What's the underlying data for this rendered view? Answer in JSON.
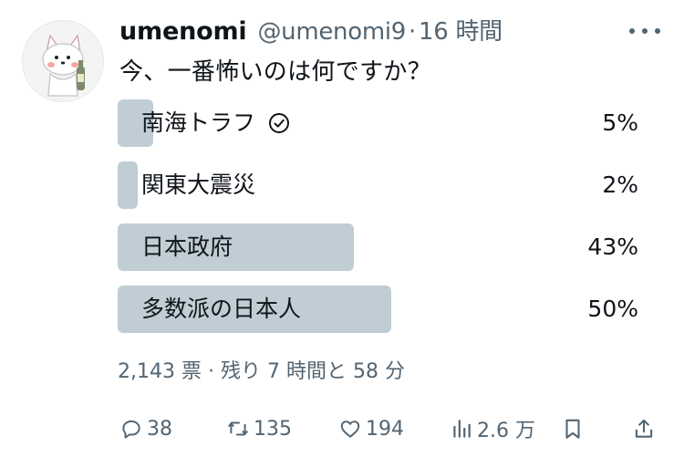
{
  "tweet": {
    "display_name": "umenomi",
    "handle": "@umenomi9",
    "separator": "·",
    "time": "16 時間",
    "text": "今、一番怖いのは何ですか？"
  },
  "poll": {
    "options": [
      {
        "label": "南海トラフ",
        "percent_text": "5%",
        "fraction": 0.05,
        "selected": true
      },
      {
        "label": "関東大震災",
        "percent_text": "2%",
        "fraction": 0.02,
        "selected": false
      },
      {
        "label": "日本政府",
        "percent_text": "43%",
        "fraction": 0.43,
        "selected": false
      },
      {
        "label": "多数派の日本人",
        "percent_text": "50%",
        "fraction": 0.5,
        "selected": false
      }
    ],
    "votes": "2,143 票",
    "dot": "·",
    "remaining": "残り 7 時間と 58 分"
  },
  "actions": {
    "replies": "38",
    "retweets": "135",
    "likes": "194",
    "views": "2.6 万"
  },
  "icons": {
    "more": "more-horizontal-icon",
    "selected": "check-circle-icon",
    "reply": "reply-icon",
    "retweet": "retweet-icon",
    "like": "heart-icon",
    "views": "views-icon",
    "bookmark": "bookmark-icon",
    "share": "share-icon"
  },
  "colors": {
    "bar": "#c0cdd4",
    "text": "#0f1419",
    "secondary": "#536471"
  }
}
